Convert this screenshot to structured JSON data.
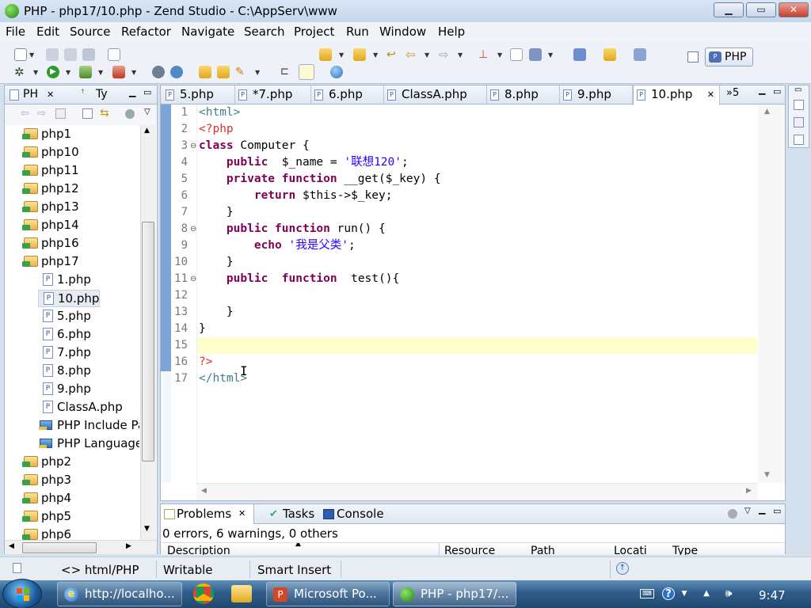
{
  "window": {
    "title": "PHP - php17/10.php - Zend Studio - C:\\AppServ\\www",
    "minimize": "▁",
    "maximize": "▭",
    "close": "✕"
  },
  "menu": [
    "File",
    "Edit",
    "Source",
    "Refactor",
    "Navigate",
    "Search",
    "Project",
    "Run",
    "Window",
    "Help"
  ],
  "perspective": {
    "label": "PHP",
    "icon": "php-perspective-icon"
  },
  "explorer": {
    "tabs": [
      "PH",
      "Ty"
    ],
    "items": [
      {
        "label": "php1",
        "type": "project",
        "indent": 0
      },
      {
        "label": "php10",
        "type": "project",
        "indent": 0
      },
      {
        "label": "php11",
        "type": "project",
        "indent": 0
      },
      {
        "label": "php12",
        "type": "project",
        "indent": 0
      },
      {
        "label": "php13",
        "type": "project",
        "indent": 0
      },
      {
        "label": "php14",
        "type": "project",
        "indent": 0
      },
      {
        "label": "php16",
        "type": "project",
        "indent": 0
      },
      {
        "label": "php17",
        "type": "project",
        "indent": 0
      },
      {
        "label": "1.php",
        "type": "file",
        "indent": 1
      },
      {
        "label": "10.php",
        "type": "file",
        "indent": 1,
        "selected": true
      },
      {
        "label": "5.php",
        "type": "file",
        "indent": 1
      },
      {
        "label": "6.php",
        "type": "file",
        "indent": 1
      },
      {
        "label": "7.php",
        "type": "file",
        "indent": 1
      },
      {
        "label": "8.php",
        "type": "file",
        "indent": 1
      },
      {
        "label": "9.php",
        "type": "file",
        "indent": 1
      },
      {
        "label": "ClassA.php",
        "type": "file",
        "indent": 1
      },
      {
        "label": "PHP Include Pa",
        "type": "library",
        "indent": 1
      },
      {
        "label": "PHP Language",
        "type": "library",
        "indent": 1
      },
      {
        "label": "php2",
        "type": "project",
        "indent": 0
      },
      {
        "label": "php3",
        "type": "project",
        "indent": 0
      },
      {
        "label": "php4",
        "type": "project",
        "indent": 0
      },
      {
        "label": "php5",
        "type": "project",
        "indent": 0
      },
      {
        "label": "php6",
        "type": "project",
        "indent": 0
      }
    ]
  },
  "editor": {
    "tabs": [
      {
        "label": "5.php",
        "active": false
      },
      {
        "label": "*7.php",
        "active": false
      },
      {
        "label": "6.php",
        "active": false
      },
      {
        "label": "ClassA.php",
        "active": false
      },
      {
        "label": "8.php",
        "active": false
      },
      {
        "label": "9.php",
        "active": false
      },
      {
        "label": "10.php",
        "active": true
      }
    ],
    "overflow": "»5",
    "current_line": 15,
    "lines": [
      {
        "n": "1",
        "fold": "",
        "parts": [
          [
            "tag",
            "<html>"
          ]
        ]
      },
      {
        "n": "2",
        "fold": "",
        "parts": [
          [
            "php",
            "<?php"
          ]
        ]
      },
      {
        "n": "3",
        "fold": "⊖",
        "parts": [
          [
            "kw",
            "class"
          ],
          [
            "var",
            " Computer {"
          ]
        ]
      },
      {
        "n": "4",
        "fold": "",
        "parts": [
          [
            "var",
            "    "
          ],
          [
            "kw",
            "public"
          ],
          [
            "var",
            "  $_name = "
          ],
          [
            "str",
            "'联想120'"
          ],
          [
            "var",
            ";"
          ]
        ]
      },
      {
        "n": "5",
        "fold": "",
        "parts": [
          [
            "var",
            "    "
          ],
          [
            "kw",
            "private"
          ],
          [
            "var",
            " "
          ],
          [
            "kw",
            "function"
          ],
          [
            "var",
            " __get($_key) {"
          ]
        ]
      },
      {
        "n": "6",
        "fold": "",
        "parts": [
          [
            "var",
            "        "
          ],
          [
            "kw",
            "return"
          ],
          [
            "var",
            " $this->$_key;"
          ]
        ]
      },
      {
        "n": "7",
        "fold": "",
        "parts": [
          [
            "var",
            "    }"
          ]
        ]
      },
      {
        "n": "8",
        "fold": "⊖",
        "parts": [
          [
            "var",
            "    "
          ],
          [
            "kw",
            "public"
          ],
          [
            "var",
            " "
          ],
          [
            "kw",
            "function"
          ],
          [
            "var",
            " run() {"
          ]
        ]
      },
      {
        "n": "9",
        "fold": "",
        "parts": [
          [
            "var",
            "        "
          ],
          [
            "kw",
            "echo"
          ],
          [
            "var",
            " "
          ],
          [
            "str",
            "'我是父类'"
          ],
          [
            "var",
            ";"
          ]
        ]
      },
      {
        "n": "10",
        "fold": "",
        "parts": [
          [
            "var",
            "    }"
          ]
        ]
      },
      {
        "n": "11",
        "fold": "⊖",
        "parts": [
          [
            "var",
            "    "
          ],
          [
            "kw",
            "public"
          ],
          [
            "var",
            "  "
          ],
          [
            "kw",
            "function"
          ],
          [
            "var",
            "  test(){"
          ]
        ]
      },
      {
        "n": "12",
        "fold": "",
        "parts": [
          [
            "var",
            ""
          ]
        ]
      },
      {
        "n": "13",
        "fold": "",
        "parts": [
          [
            "var",
            "    }"
          ]
        ]
      },
      {
        "n": "14",
        "fold": "",
        "parts": [
          [
            "var",
            "}"
          ]
        ]
      },
      {
        "n": "15",
        "fold": "",
        "parts": [
          [
            "var",
            ""
          ]
        ]
      },
      {
        "n": "16",
        "fold": "",
        "parts": [
          [
            "php",
            "?>"
          ]
        ]
      },
      {
        "n": "17",
        "fold": "",
        "parts": [
          [
            "tag",
            "</html>"
          ]
        ]
      }
    ]
  },
  "problems": {
    "tabs": [
      {
        "label": "Problems",
        "icon": "problems-icon"
      },
      {
        "label": "Tasks",
        "icon": "tasks-icon"
      },
      {
        "label": "Console",
        "icon": "console-icon"
      }
    ],
    "summary": "0 errors, 6 warnings, 0 others",
    "columns": [
      "Description",
      "Resource",
      "Path",
      "Locati",
      "Type"
    ]
  },
  "status": {
    "breadcrumb": "<> html/PHP",
    "writable": "Writable",
    "insert_mode": "Smart Insert"
  },
  "taskbar": {
    "items": [
      {
        "label": "http://localho...",
        "icon": "ie-icon",
        "active": false
      },
      {
        "label": "Microsoft Po...",
        "icon": "powerpoint-icon",
        "active": false
      },
      {
        "label": "PHP - php17/...",
        "icon": "zend-icon",
        "active": true
      }
    ],
    "clock": "9:47"
  },
  "colors": {
    "keyword": "#7f0055",
    "string": "#2a00ff",
    "tag": "#3f7f7f",
    "php_delim": "#e0302a",
    "current_line": "#ffffcc"
  }
}
